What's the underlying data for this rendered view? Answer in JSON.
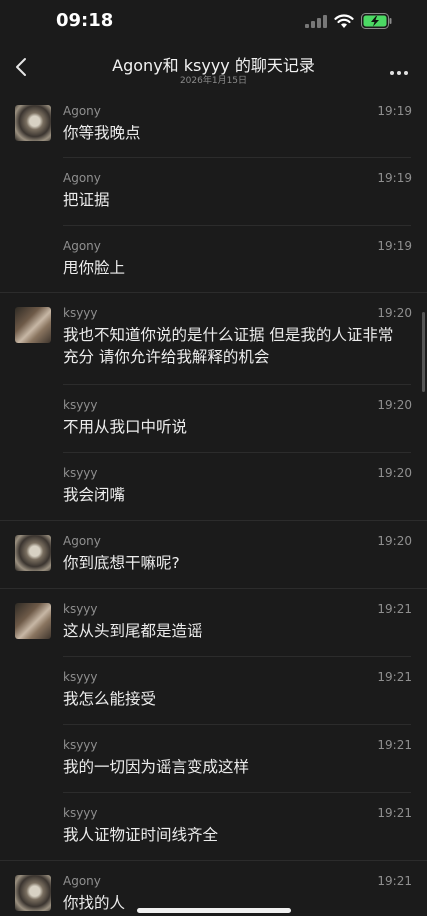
{
  "status": {
    "time": "09:18"
  },
  "nav": {
    "title": "Agony和 ksyyy 的聊天记录",
    "subtitle": "2026年1月15日"
  },
  "messages": [
    {
      "sender": "Agony",
      "time": "19:19",
      "text": "你等我晚点",
      "avatar": "agony"
    },
    {
      "sender": "Agony",
      "time": "19:19",
      "text": "把证据"
    },
    {
      "sender": "Agony",
      "time": "19:19",
      "text": "甩你脸上"
    },
    {
      "sender": "ksyyy",
      "time": "19:20",
      "text": "我也不知道你说的是什么证据 但是我的人证非常充分 请你允许给我解释的机会",
      "avatar": "ksyyy"
    },
    {
      "sender": "ksyyy",
      "time": "19:20",
      "text": "不用从我口中听说"
    },
    {
      "sender": "ksyyy",
      "time": "19:20",
      "text": "我会闭嘴"
    },
    {
      "sender": "Agony",
      "time": "19:20",
      "text": "你到底想干嘛呢?",
      "avatar": "agony"
    },
    {
      "sender": "ksyyy",
      "time": "19:21",
      "text": "这从头到尾都是造谣",
      "avatar": "ksyyy"
    },
    {
      "sender": "ksyyy",
      "time": "19:21",
      "text": "我怎么能接受"
    },
    {
      "sender": "ksyyy",
      "time": "19:21",
      "text": "我的一切因为谣言变成这样"
    },
    {
      "sender": "ksyyy",
      "time": "19:21",
      "text": "我人证物证时间线齐全"
    },
    {
      "sender": "Agony",
      "time": "19:21",
      "text": "你找的人",
      "avatar": "agony"
    }
  ]
}
